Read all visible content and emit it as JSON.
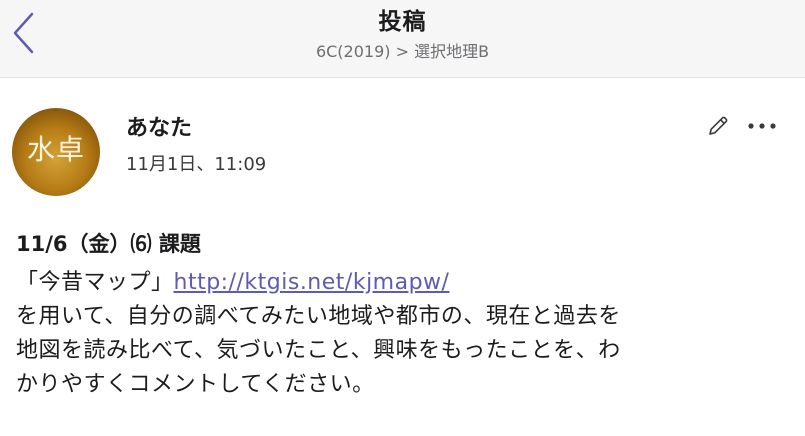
{
  "header": {
    "title": "投稿",
    "subtitle": "6C(2019) > 選択地理B"
  },
  "post": {
    "avatar_text": "水卓",
    "author": "あなた",
    "date": "11月1日、11:09",
    "title": "11/6（金）⑹ 課題",
    "body": {
      "prefix": "「今昔マップ」",
      "link": "http://ktgis.net/kjmapw/",
      "line2": "を用いて、自分の調べてみたい地域や都市の、現在と過去を",
      "line3": "地図を読み比べて、気づいたこと、興味をもったことを、わ",
      "line4": "かりやすくコメントしてください。"
    }
  },
  "icons": {
    "back": "chevron-left-icon",
    "edit": "pencil-icon",
    "more": "more-horizontal-icon"
  },
  "colors": {
    "accent": "#5f5bb4",
    "header_bg": "#f6f6f6"
  }
}
